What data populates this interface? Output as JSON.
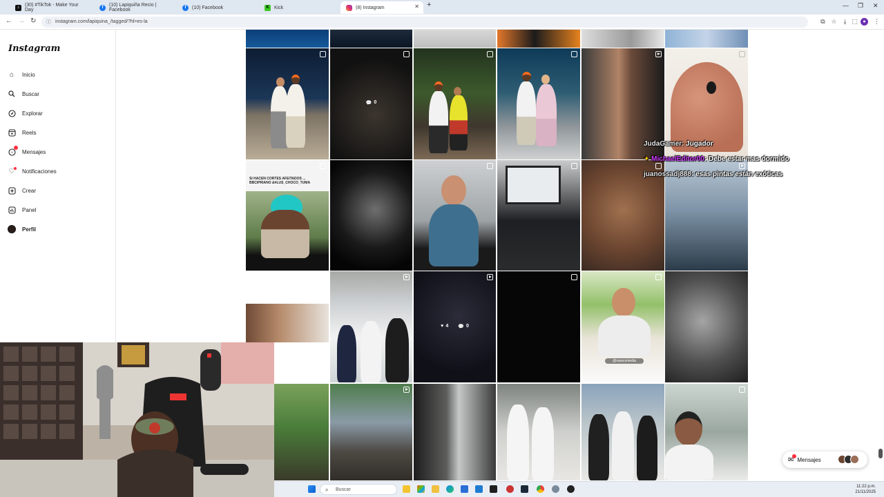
{
  "browser": {
    "tabs": [
      {
        "label": "(30) #TikTok - Make Your Day",
        "favicon": "tiktok-icon",
        "active": false
      },
      {
        "label": "(10) Lapiquiña Recio | Facebook",
        "favicon": "facebook-icon",
        "active": false
      },
      {
        "label": "(10) Facebook",
        "favicon": "facebook-icon",
        "active": false
      },
      {
        "label": "Kick",
        "favicon": "kick-icon",
        "active": false
      },
      {
        "label": "(8) Instagram",
        "favicon": "instagram-icon",
        "active": true
      }
    ],
    "new_tab": "+",
    "url": "instagram.com/lapiquina_/tagged/?hl=es-la",
    "colors": {
      "chrome": "#dfe7f1",
      "profile": "#6b2fb3"
    }
  },
  "instagram": {
    "logo": "Instagram",
    "nav": [
      {
        "label": "Inicio",
        "icon": "home-icon"
      },
      {
        "label": "Buscar",
        "icon": "search-icon"
      },
      {
        "label": "Explorar",
        "icon": "compass-icon"
      },
      {
        "label": "Reels",
        "icon": "reels-icon"
      },
      {
        "label": "Mensajes",
        "icon": "messenger-icon",
        "badge": true
      },
      {
        "label": "Notificaciones",
        "icon": "heart-icon",
        "badge": true
      },
      {
        "label": "Crear",
        "icon": "plus-square-icon"
      },
      {
        "label": "Panel",
        "icon": "dashboard-icon"
      },
      {
        "label": "Perfil",
        "icon": "avatar-icon"
      }
    ],
    "grid_stats": [
      {
        "comments": "0"
      },
      {
        "likes": "4",
        "comments": "0"
      }
    ],
    "messages_pill": {
      "label": "Mensajes"
    }
  },
  "chat": [
    {
      "user": "JudaGamer",
      "message": "Jugador"
    },
    {
      "user": "MichaelEditor00",
      "message": "Debe estar mas dormido"
    },
    {
      "user": "juanossadj888",
      "message": "esas pintas están exóticas"
    }
  ],
  "overlay_text": {
    "cell_caption": "@rasacomedia",
    "cell_banner": "SI HACEN CORTES AFEITADOS ...",
    "cell_banner_sub": "BBCIPRIANO  &#LUS_CHOCO_TUMA"
  },
  "taskbar": {
    "search_placeholder": "Buscar",
    "time": "11:22 p.m.",
    "date": "21/11/2025"
  }
}
